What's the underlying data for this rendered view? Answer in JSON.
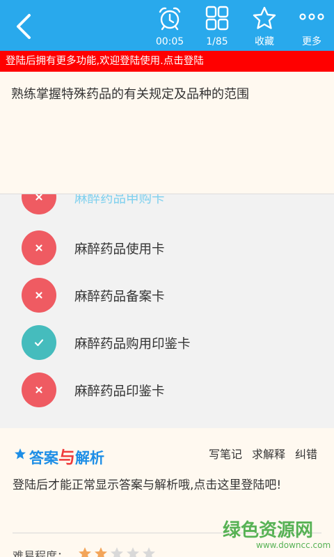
{
  "toolbar": {
    "timer": "00:05",
    "progress": "1/85",
    "favorite_label": "收藏",
    "more_label": "更多"
  },
  "login_banner": "登陆后拥有更多功能,欢迎登陆使用.点击登陆",
  "question": "熟练掌握特殊药品的有关规定及品种的范围",
  "options": [
    {
      "text": "麻醉药品申购卡",
      "status": "wrong"
    },
    {
      "text": "麻醉药品使用卡",
      "status": "wrong"
    },
    {
      "text": "麻醉药品备案卡",
      "status": "wrong"
    },
    {
      "text": "麻醉药品购用印鉴卡",
      "status": "correct"
    },
    {
      "text": "麻醉药品印鉴卡",
      "status": "wrong"
    }
  ],
  "analysis": {
    "title_left": "答案",
    "title_mid": "与",
    "title_right": "解析",
    "actions": [
      "写笔记",
      "求解释",
      "纠错"
    ],
    "login_message": "登陆后才能正常显示答案与解析哦,点击这里登陆吧!",
    "difficulty_label": "难易程度：",
    "difficulty_rating": 2,
    "difficulty_max": 5
  },
  "watermark": {
    "main": "绿色资源网",
    "sub": "www.downcc.com"
  },
  "colors": {
    "header": "#29a9ec",
    "banner": "#ff0000",
    "wrong": "#ef5b62",
    "correct": "#45bcbd",
    "analysis_title": "#1d8ee6"
  }
}
